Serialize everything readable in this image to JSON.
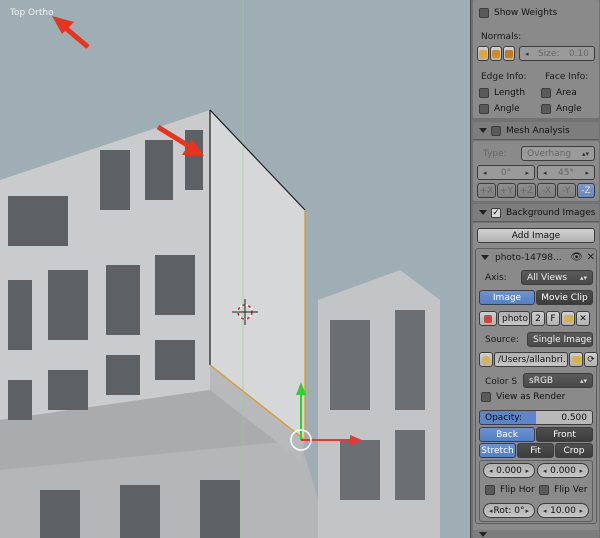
{
  "viewport": {
    "view_label": "Top Ortho"
  },
  "overlays": {
    "show_weights": "Show Weights",
    "normals_label": "Normals:",
    "size_field": "Size:",
    "size_value": "0.10",
    "edge_info": "Edge Info:",
    "face_info": "Face Info:",
    "length": "Length",
    "area": "Area",
    "angle_edge": "Angle",
    "angle_face": "Angle"
  },
  "mesh_analysis": {
    "title": "Mesh Analysis",
    "type_label": "Type:",
    "type_value": "Overhang",
    "min_value": "0°",
    "max_value": "45°",
    "axes": [
      "+X",
      "+Y",
      "+Z",
      "-X",
      "-Y",
      "-Z"
    ]
  },
  "background_images": {
    "title": "Background Images",
    "add_image": "Add Image",
    "item_name": "photo-14798...",
    "axis_label": "Axis:",
    "axis_value": "All Views",
    "tab_image": "Image",
    "tab_movie_clip": "Movie Clip",
    "image_name": "photo",
    "users": "2",
    "fake_user": "F",
    "source_label": "Source:",
    "source_value": "Single Image",
    "filepath": "/Users/allanbri...",
    "color_space_label": "Color S",
    "color_space_value": "sRGB",
    "view_as_render": "View as Render",
    "opacity_label": "Opacity:",
    "opacity_value": "0.500",
    "back": "Back",
    "front": "Front",
    "stretch": "Stretch",
    "fit": "Fit",
    "crop": "Crop",
    "offset_x": "0.000",
    "offset_y": "0.000",
    "flip_hor": "Flip Hor",
    "flip_ver": "Flip Ver",
    "rotation": "Rot: 0°",
    "size": "10.00"
  },
  "colors": {
    "accent_blue": "#5680c4",
    "arrow_red": "#e8341c",
    "axis_x": "#e53935",
    "axis_y": "#2fd12f"
  }
}
